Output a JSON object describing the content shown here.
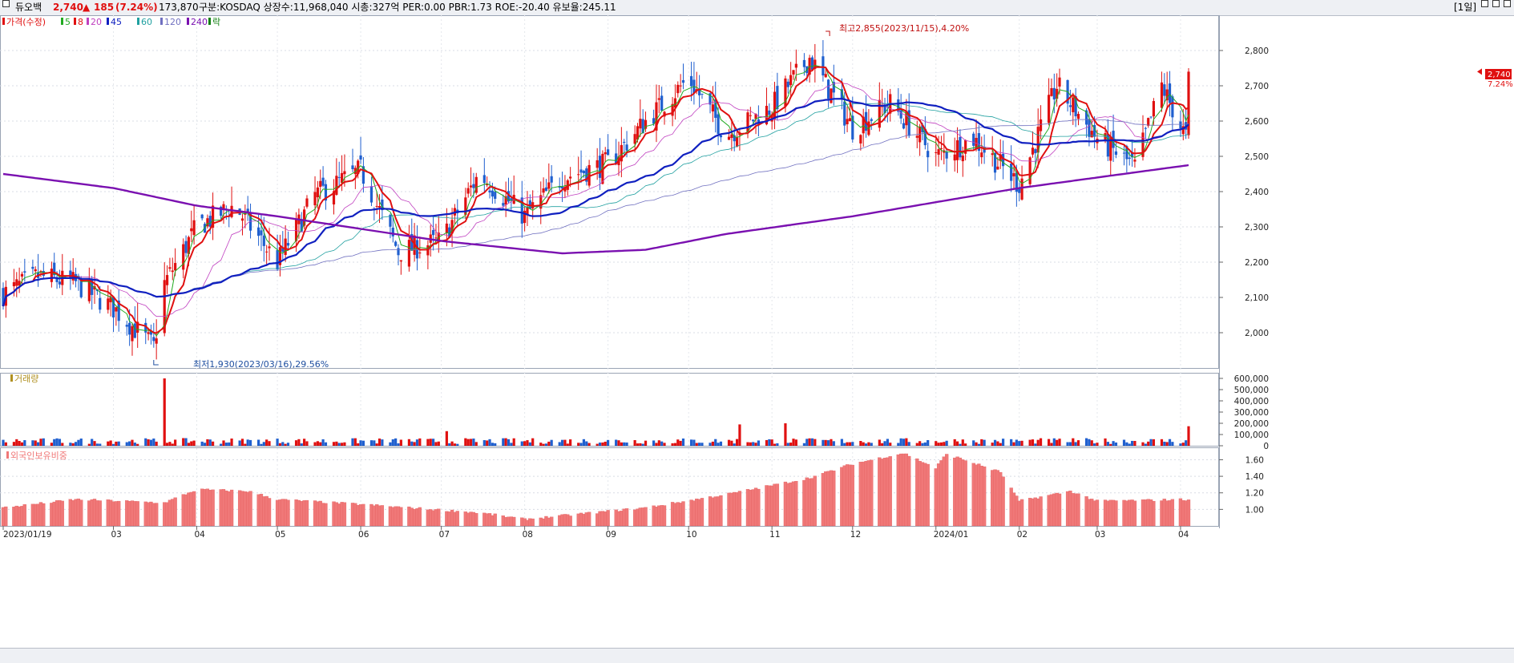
{
  "header": {
    "stock_name": "듀오백",
    "price": "2,740",
    "change_arrow": "▲",
    "change": "185",
    "change_pct": "(7.24%)",
    "volume": "173,870",
    "info": "구분:KOSDAQ 상장수:11,968,040 시총:327억 PER:0.00 PBR:1.73 ROE:-20.40 유보율:245.11",
    "period": "[1일]"
  },
  "legend": {
    "price_label": "가격(수정)",
    "ma": [
      {
        "label": "5",
        "color": "#22aa22"
      },
      {
        "label": "8",
        "color": "#e01010"
      },
      {
        "label": "20",
        "color": "#c040c0"
      },
      {
        "label": "45",
        "color": "#1020c0"
      },
      {
        "label": "60",
        "color": "#20a0a0"
      },
      {
        "label": "120",
        "color": "#7070c0"
      },
      {
        "label": "240",
        "color": "#7a10b0"
      }
    ],
    "extra": "락",
    "volume_label": "거래량",
    "foreign_label": "외국인보유비중"
  },
  "annotations": {
    "high": "최고2,855(2023/11/15),4.20%",
    "low": "최저1,930(2023/03/16),29.56%"
  },
  "price_marker": {
    "price": "2,740",
    "pct": "7.24%"
  },
  "colors": {
    "up": "#e01010",
    "down": "#1f5fcf",
    "foreign_bar": "#f07878",
    "ma240": "#7a10b0",
    "ma45": "#1020c0"
  },
  "chart_data": [
    {
      "type": "candlestick",
      "title": "듀오백",
      "ylim": [
        1900,
        2900
      ],
      "yticks": [
        2000,
        2100,
        2200,
        2300,
        2400,
        2500,
        2600,
        2700,
        2800
      ],
      "ytick_labels": [
        "2,000",
        "2,100",
        "2,200",
        "2,300",
        "2,400",
        "2,500",
        "2,600",
        "2,700",
        "2,800"
      ],
      "x_labels": [
        "2023/01/19",
        "03",
        "04",
        "05",
        "06",
        "07",
        "08",
        "09",
        "10",
        "11",
        "12",
        "2024/01",
        "02",
        "03",
        "04"
      ],
      "close_anchors": [
        {
          "date": "2023/01/19",
          "close": 2110
        },
        {
          "date": "2023/02/01",
          "close": 2160
        },
        {
          "date": "2023/02/15",
          "close": 2140
        },
        {
          "date": "2023/03/01",
          "close": 2070
        },
        {
          "date": "2023/03/16",
          "close": 1960
        },
        {
          "date": "2023/03/20",
          "close": 2140
        },
        {
          "date": "2023/04/01",
          "close": 2300
        },
        {
          "date": "2023/04/15",
          "close": 2360
        },
        {
          "date": "2023/05/01",
          "close": 2200
        },
        {
          "date": "2023/05/15",
          "close": 2390
        },
        {
          "date": "2023/06/01",
          "close": 2460
        },
        {
          "date": "2023/06/15",
          "close": 2230
        },
        {
          "date": "2023/07/01",
          "close": 2260
        },
        {
          "date": "2023/07/15",
          "close": 2450
        },
        {
          "date": "2023/08/01",
          "close": 2330
        },
        {
          "date": "2023/08/15",
          "close": 2440
        },
        {
          "date": "2023/09/01",
          "close": 2480
        },
        {
          "date": "2023/09/15",
          "close": 2600
        },
        {
          "date": "2023/10/01",
          "close": 2720
        },
        {
          "date": "2023/10/15",
          "close": 2560
        },
        {
          "date": "2023/11/01",
          "close": 2640
        },
        {
          "date": "2023/11/15",
          "close": 2780
        },
        {
          "date": "2023/12/01",
          "close": 2580
        },
        {
          "date": "2023/12/15",
          "close": 2650
        },
        {
          "date": "2024/01/01",
          "close": 2500
        },
        {
          "date": "2024/01/15",
          "close": 2550
        },
        {
          "date": "2024/02/01",
          "close": 2420
        },
        {
          "date": "2024/02/15",
          "close": 2700
        },
        {
          "date": "2024/03/01",
          "close": 2550
        },
        {
          "date": "2024/03/15",
          "close": 2470
        },
        {
          "date": "2024/03/25",
          "close": 2700
        },
        {
          "date": "2024/04/03",
          "close": 2555
        },
        {
          "date": "2024/04/04",
          "close": 2740
        }
      ],
      "ma240_anchors": [
        {
          "date": "2023/01/19",
          "value": 2450
        },
        {
          "date": "2023/03/01",
          "value": 2410
        },
        {
          "date": "2023/04/01",
          "value": 2360
        },
        {
          "date": "2023/05/01",
          "value": 2330
        },
        {
          "date": "2023/07/01",
          "value": 2260
        },
        {
          "date": "2023/08/15",
          "value": 2225
        },
        {
          "date": "2023/09/15",
          "value": 2235
        },
        {
          "date": "2023/10/15",
          "value": 2280
        },
        {
          "date": "2023/12/01",
          "value": 2330
        },
        {
          "date": "2024/01/01",
          "value": 2370
        },
        {
          "date": "2024/02/01",
          "value": 2410
        },
        {
          "date": "2024/03/01",
          "value": 2440
        },
        {
          "date": "2024/04/04",
          "value": 2475
        }
      ]
    },
    {
      "type": "bar",
      "title": "거래량",
      "ylim": [
        0,
        650000
      ],
      "yticks": [
        0,
        100000,
        200000,
        300000,
        400000,
        500000,
        600000
      ],
      "ytick_labels": [
        "0",
        "100,000",
        "200,000",
        "300,000",
        "400,000",
        "500,000",
        "600,000"
      ],
      "typical_volume": 40000,
      "spikes": [
        {
          "date": "2023/03/20",
          "value": 600000
        },
        {
          "date": "2023/11/06",
          "value": 200000
        },
        {
          "date": "2023/10/20",
          "value": 190000
        },
        {
          "date": "2023/07/03",
          "value": 130000
        },
        {
          "date": "2024/04/04",
          "value": 173870
        }
      ]
    },
    {
      "type": "bar",
      "title": "외국인보유비중",
      "ylim": [
        0.8,
        1.75
      ],
      "yticks": [
        1.0,
        1.2,
        1.4,
        1.6
      ],
      "ytick_labels": [
        "1.00",
        "1.20",
        "1.40",
        "1.60"
      ],
      "anchors": [
        {
          "date": "2023/01/19",
          "value": 1.02
        },
        {
          "date": "2023/02/15",
          "value": 1.12
        },
        {
          "date": "2023/03/20",
          "value": 1.08
        },
        {
          "date": "2023/04/01",
          "value": 1.24
        },
        {
          "date": "2023/04/20",
          "value": 1.22
        },
        {
          "date": "2023/05/01",
          "value": 1.12
        },
        {
          "date": "2023/06/01",
          "value": 1.06
        },
        {
          "date": "2023/07/15",
          "value": 0.96
        },
        {
          "date": "2023/08/01",
          "value": 0.88
        },
        {
          "date": "2023/09/15",
          "value": 1.02
        },
        {
          "date": "2023/10/15",
          "value": 1.18
        },
        {
          "date": "2023/11/15",
          "value": 1.38
        },
        {
          "date": "2023/12/01",
          "value": 1.55
        },
        {
          "date": "2023/12/20",
          "value": 1.68
        },
        {
          "date": "2024/01/01",
          "value": 1.5
        },
        {
          "date": "2024/01/05",
          "value": 1.67
        },
        {
          "date": "2024/01/25",
          "value": 1.45
        },
        {
          "date": "2024/02/01",
          "value": 1.1
        },
        {
          "date": "2024/02/20",
          "value": 1.22
        },
        {
          "date": "2024/03/01",
          "value": 1.1
        },
        {
          "date": "2024/04/04",
          "value": 1.12
        }
      ]
    }
  ]
}
